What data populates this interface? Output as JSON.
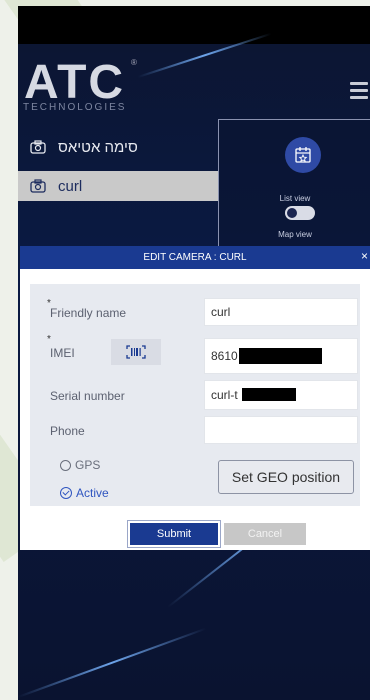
{
  "brand": {
    "logo_text": "ATC",
    "logo_sub": "TECHNOLOGIES",
    "registered": "®"
  },
  "cameras": [
    {
      "label": "סימה אטיאס",
      "icon": "camera-icon",
      "selected": false
    },
    {
      "label": "curl",
      "icon": "camera-icon",
      "selected": true
    }
  ],
  "side_panel": {
    "list_view_label": "List view",
    "map_view_label": "Map view"
  },
  "modal": {
    "title": "EDIT CAMERA : CURL",
    "close": "×",
    "fields": {
      "friendly_name": {
        "label": "Friendly name",
        "value": "curl"
      },
      "imei": {
        "label": "IMEI",
        "value": "8610"
      },
      "serial_number": {
        "label": "Serial number",
        "value": "curl-t"
      },
      "phone": {
        "label": "Phone",
        "value": ""
      }
    },
    "gps_label": "GPS",
    "active_label": "Active",
    "set_geo_label": "Set GEO position",
    "submit_label": "Submit",
    "cancel_label": "Cancel"
  },
  "colors": {
    "accent": "#1a3a91",
    "selected_row": "#c9c9c9",
    "background": "#0a1a44"
  }
}
